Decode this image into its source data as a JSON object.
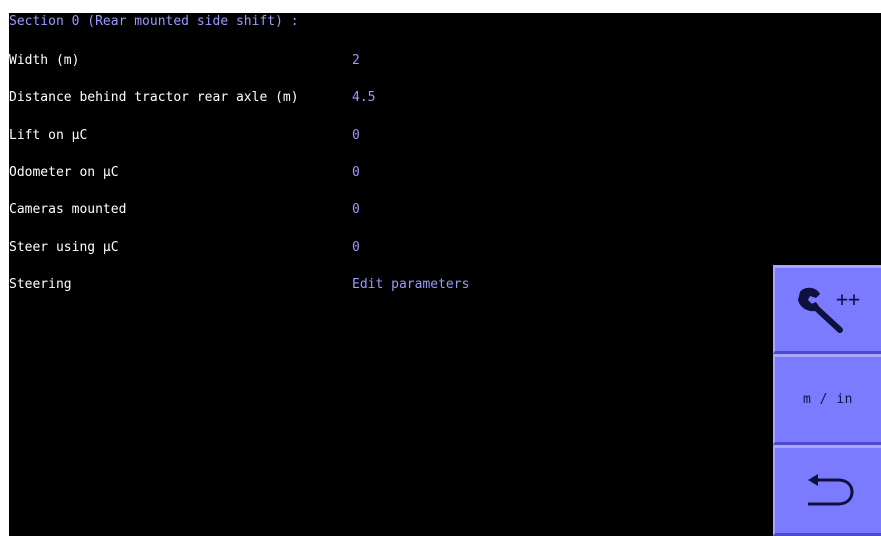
{
  "section": {
    "title": "Section 0 (Rear mounted side shift) :"
  },
  "parameters": [
    {
      "label": "Width (m)",
      "value": "2"
    },
    {
      "label": "Distance behind tractor rear axle (m)",
      "value": "4.5"
    },
    {
      "label": "Lift on µC",
      "value": "0"
    },
    {
      "label": "Odometer on µC",
      "value": "0"
    },
    {
      "label": "Cameras mounted",
      "value": "0"
    },
    {
      "label": "Steer using µC",
      "value": "0"
    },
    {
      "label": "Steering",
      "value": "Edit parameters"
    }
  ],
  "sidebar": {
    "tools_button": {
      "icon": "wrench-icon",
      "text": "++"
    },
    "units_button": {
      "label": "m / in"
    },
    "back_button": {
      "icon": "back-arrow-icon"
    }
  },
  "colors": {
    "background": "#000000",
    "title_text": "#9a9aff",
    "label_text": "#ffffff",
    "value_text": "#9a9aff",
    "button_fill": "#7b7bff",
    "icon_color": "#101040"
  }
}
